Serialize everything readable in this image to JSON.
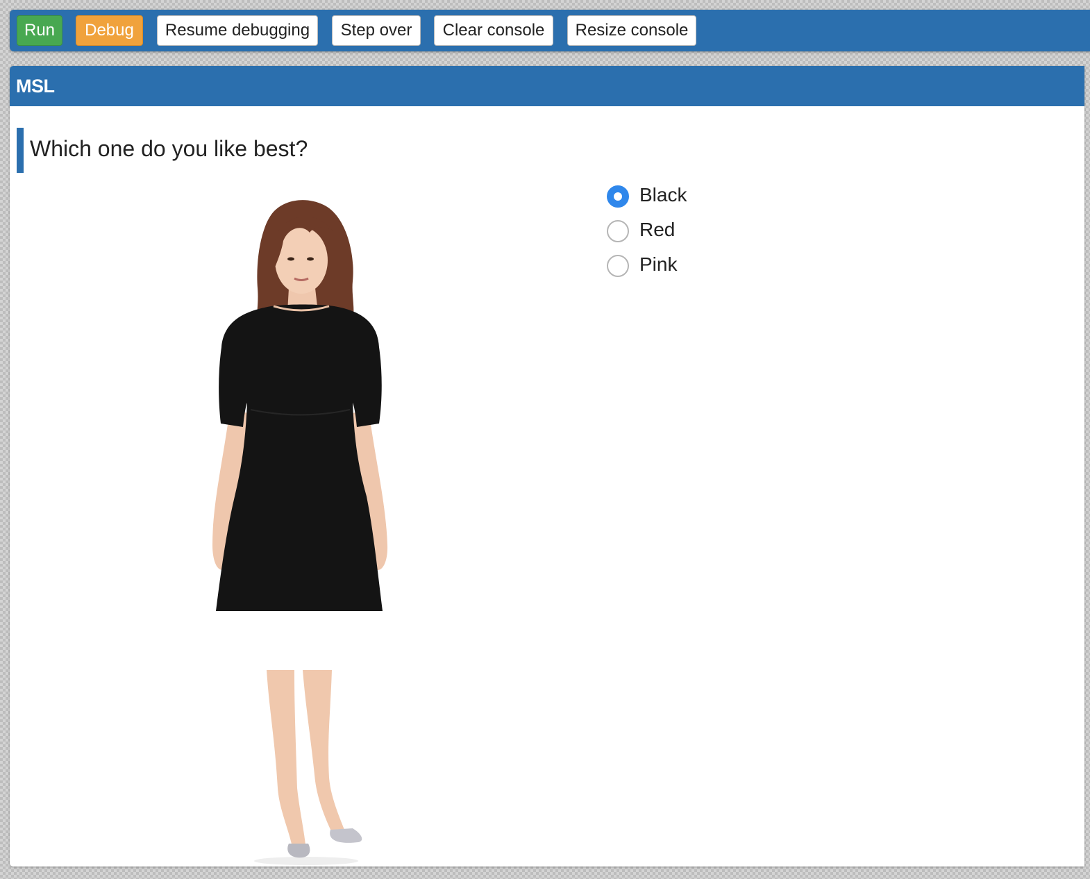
{
  "toolbar": {
    "run_label": "Run",
    "debug_label": "Debug",
    "resume_label": "Resume debugging",
    "step_label": "Step over",
    "clear_label": "Clear console",
    "resize_label": "Resize console"
  },
  "panel": {
    "title": "MSL",
    "question": "Which one do you like best?",
    "image_icon": "person-in-dress-photo",
    "options": [
      {
        "label": "Black",
        "checked": true
      },
      {
        "label": "Red",
        "checked": false
      },
      {
        "label": "Pink",
        "checked": false
      }
    ]
  },
  "colors": {
    "accent": "#2b6fae",
    "run": "#48a851",
    "debug": "#f0a23c",
    "radio_selected": "#2f87eb"
  }
}
